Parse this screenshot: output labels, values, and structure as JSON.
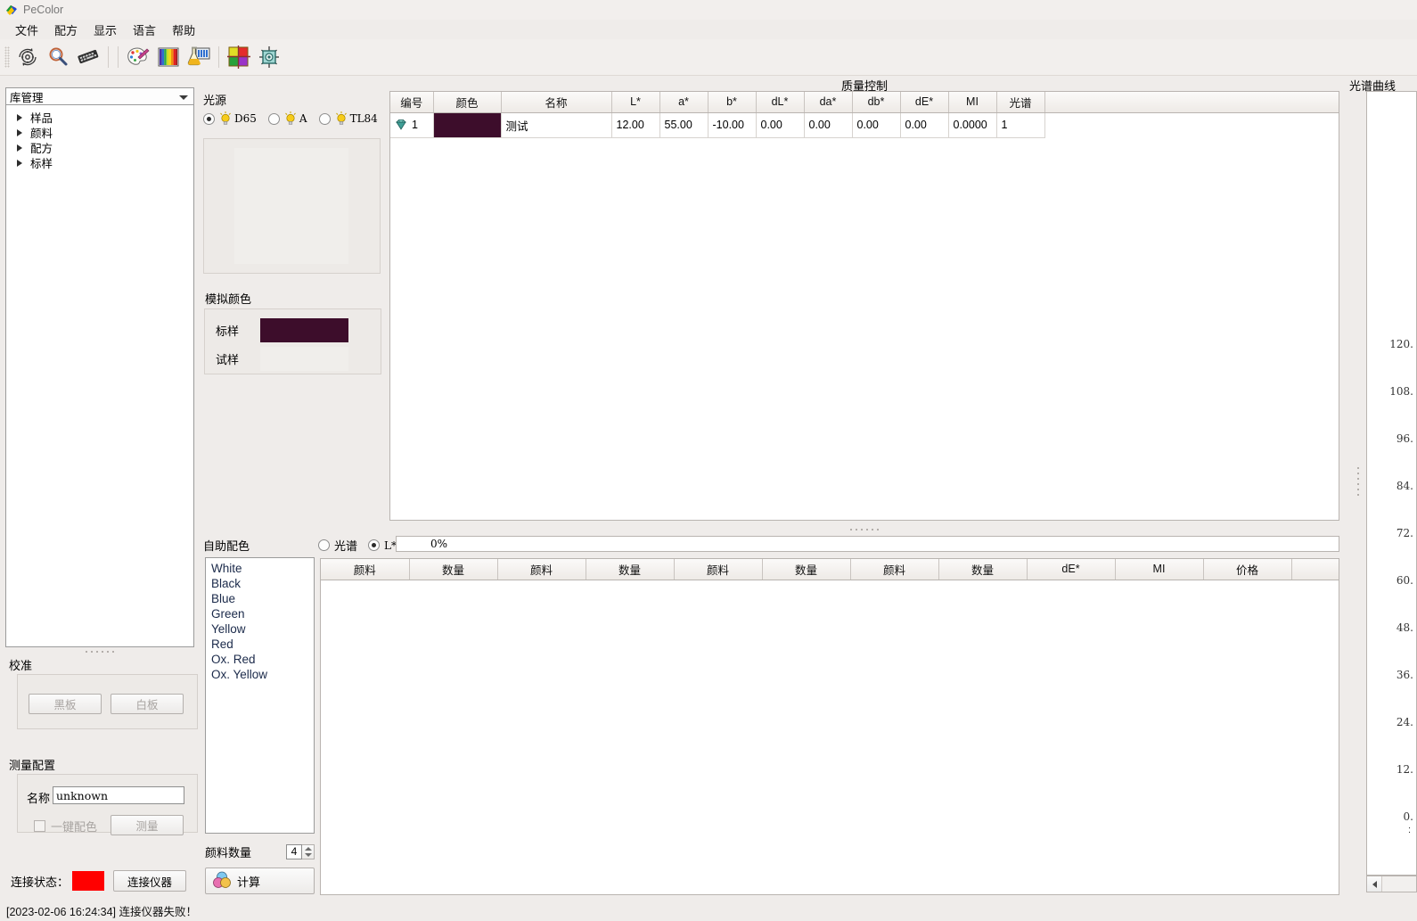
{
  "window": {
    "title": "PeColor",
    "app_icon": "pecolor-logo-icon"
  },
  "menubar": {
    "items": [
      {
        "label": "文件",
        "name": "menu-file"
      },
      {
        "label": "配方",
        "name": "menu-recipe"
      },
      {
        "label": "显示",
        "name": "menu-display"
      },
      {
        "label": "语言",
        "name": "menu-language"
      },
      {
        "label": "帮助",
        "name": "menu-help"
      }
    ]
  },
  "toolbar": {
    "buttons": [
      {
        "icon": "gear-refresh-icon",
        "group": 1
      },
      {
        "icon": "magnifier-search-icon",
        "group": 1
      },
      {
        "icon": "keyboard-icon",
        "group": 1
      },
      {
        "icon": "palette-icon",
        "group": 2
      },
      {
        "icon": "rainbow-spectrum-icon",
        "group": 2
      },
      {
        "icon": "lab-flask-icon",
        "group": 2
      },
      {
        "icon": "color-wheel-grid-icon",
        "group": 3
      },
      {
        "icon": "sensor-chip-icon",
        "group": 3
      }
    ]
  },
  "library": {
    "combo_value": "库管理",
    "nodes": [
      {
        "label": "样品",
        "name": "tree-node-samples"
      },
      {
        "label": "颜料",
        "name": "tree-node-pigments"
      },
      {
        "label": "配方",
        "name": "tree-node-recipes"
      },
      {
        "label": "标样",
        "name": "tree-node-standards"
      }
    ]
  },
  "calibration": {
    "title": "校准",
    "black_button": "黑板",
    "white_button": "白板"
  },
  "measurement": {
    "title": "测量配置",
    "name_label": "名称",
    "name_value": "unknown",
    "name_placeholder": "",
    "onekey_label": "一键配色",
    "onekey_checked": false,
    "measure_button": "测量"
  },
  "connection": {
    "label": "连接状态：",
    "led_color": "#ff0000",
    "button": "连接仪器"
  },
  "statusbar": {
    "text": "[2023-02-06 16:24:34] 连接仪器失败！"
  },
  "light_source": {
    "title": "光源",
    "options": [
      {
        "label": "D65",
        "selected": true,
        "name": "radio-illuminant-d65"
      },
      {
        "label": "A",
        "selected": false,
        "name": "radio-illuminant-a"
      },
      {
        "label": "TL84",
        "selected": false,
        "name": "radio-illuminant-tl84"
      }
    ]
  },
  "simulated_color": {
    "title": "模拟颜色",
    "standard_label": "标样",
    "standard_color": "#3d0d2b",
    "sample_label": "试样",
    "sample_color": "#f0eeeb"
  },
  "auto_match": {
    "title": "自助配色",
    "mode_options": [
      {
        "label": "光谱",
        "selected": false,
        "name": "radio-mode-spectrum"
      },
      {
        "label": "L*a*b*",
        "selected": true,
        "name": "radio-mode-lab"
      }
    ],
    "pigments": [
      "White",
      "Black",
      "Blue",
      "Green",
      "Yellow",
      "Red",
      "Ox. Red",
      "Ox. Yellow"
    ],
    "pigment_count_label": "颜料数量",
    "pigment_count_value": "4",
    "calculate_button": "计算",
    "calculate_icon": "color-mix-icon"
  },
  "progress": {
    "text": "0%",
    "value": 0
  },
  "quality_control": {
    "title": "质量控制",
    "columns": [
      "编号",
      "颜色",
      "名称",
      "L*",
      "a*",
      "b*",
      "dL*",
      "da*",
      "db*",
      "dE*",
      "MI",
      "光谱"
    ],
    "rows": [
      {
        "编号": "1",
        "row_icon": "gem-standard-icon",
        "颜色": "#3d0d2b",
        "名称": "测试",
        "L*": "12.00",
        "a*": "55.00",
        "b*": "-10.00",
        "dL*": "0.00",
        "da*": "0.00",
        "db*": "0.00",
        "dE*": "0.00",
        "MI": "0.0000",
        "光谱": "1"
      }
    ]
  },
  "recipe_table": {
    "columns": [
      "颜料",
      "数量",
      "颜料",
      "数量",
      "颜料",
      "数量",
      "颜料",
      "数量",
      "dE*",
      "MI",
      "价格"
    ],
    "rows": []
  },
  "chart_data": {
    "type": "line",
    "title": "光谱曲线",
    "xlabel": "",
    "ylabel": "",
    "series": [],
    "x": [],
    "ytick_labels": [
      "120.",
      "108.",
      "96.",
      "84.",
      "72.",
      "60.",
      "48.",
      "36.",
      "24.",
      "12.",
      "0."
    ],
    "ytick_values": [
      120,
      108,
      96,
      84,
      72,
      60,
      48,
      36,
      24,
      12,
      0
    ],
    "ylim": [
      0,
      126
    ],
    "grid": false,
    "legend": "none",
    "note": "panel is clipped at the right window edge; only y-axis tick labels visible"
  }
}
